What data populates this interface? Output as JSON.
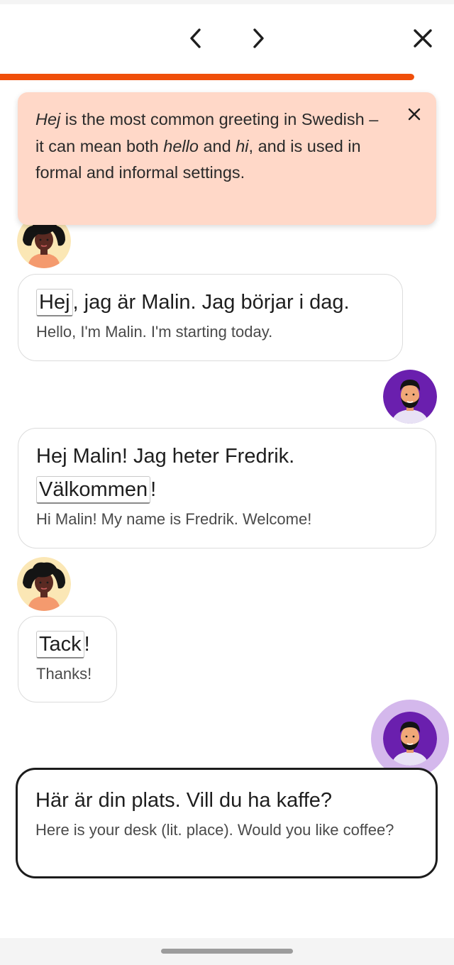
{
  "navigation": {
    "previous_icon": "chevron-left-icon",
    "next_icon": "chevron-right-icon",
    "close_icon": "close-icon"
  },
  "progress": {
    "value": 1.0,
    "color": "#f04f0a"
  },
  "tip": {
    "part1": "Hej",
    "part2": " is the most common greeting in Swedish – it can mean both ",
    "part3": "hello",
    "part4": " and ",
    "part5": "hi",
    "part6": ", and is used in formal and informal settings.",
    "close_icon": "close-icon",
    "background_color": "#ffd8c8"
  },
  "messages": [
    {
      "speaker": "Malin",
      "highlight": "Hej",
      "rest": ", jag är Malin. Jag börjar i dag.",
      "translation": "Hello, I'm Malin. I'm starting today."
    },
    {
      "speaker": "Fredrik",
      "pre": "Hej Malin! Jag heter Fredrik.",
      "highlight": "Välkommen",
      "rest": "!",
      "translation": "Hi Malin! My name is Fredrik. Welcome!"
    },
    {
      "speaker": "Malin",
      "highlight": "Tack",
      "rest": "!",
      "translation": "Thanks!"
    },
    {
      "speaker": "Fredrik",
      "text": "Här är din plats. Vill du ha kaffe?",
      "translation": "Here is your desk (lit. place). Would you like coffee?",
      "active": true
    }
  ],
  "colors": {
    "accent": "#f04f0a",
    "fredrik_avatar": "#6a1fae",
    "malin_avatar": "#fbe7b5",
    "active_glow": "#d4b8ec"
  }
}
